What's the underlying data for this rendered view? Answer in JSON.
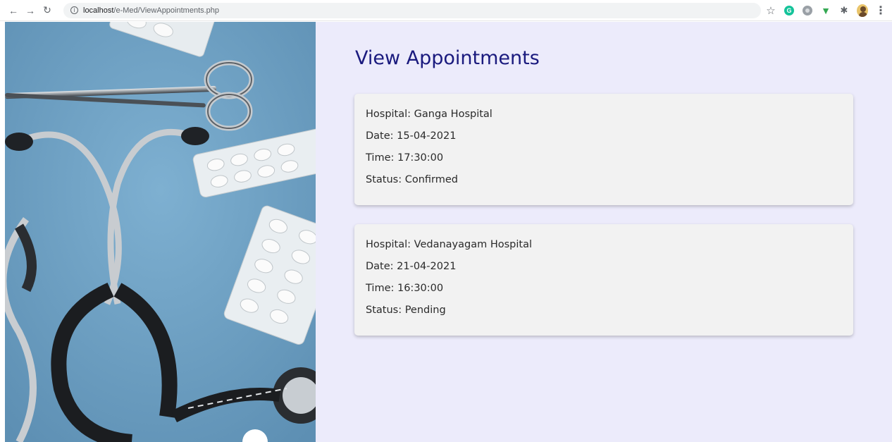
{
  "browser": {
    "url_host": "localhost",
    "url_path": "/e-Med/ViewAppointments.php",
    "nav_icons": [
      "back-icon",
      "forward-icon",
      "reload-icon"
    ],
    "extension_icons": [
      "star-icon",
      "grammarly-icon",
      "extension-icon",
      "shield-icon",
      "puzzle-icon",
      "avatar",
      "menu-icon"
    ]
  },
  "page": {
    "title": "View Appointments"
  },
  "appointments": [
    {
      "hospital": "Hospital: Ganga Hospital",
      "date": "Date: 15-04-2021",
      "time": "Time: 17:30:00",
      "status": "Status: Confirmed"
    },
    {
      "hospital": "Hospital: Vedanayagam Hospital",
      "date": "Date: 21-04-2021",
      "time": "Time: 16:30:00",
      "status": "Status: Pending"
    }
  ],
  "colors": {
    "title": "#1a1a7e",
    "content_bg": "#ecebfb",
    "card_bg": "#f2f2f2",
    "hero_bg": "#6d9fc2"
  }
}
